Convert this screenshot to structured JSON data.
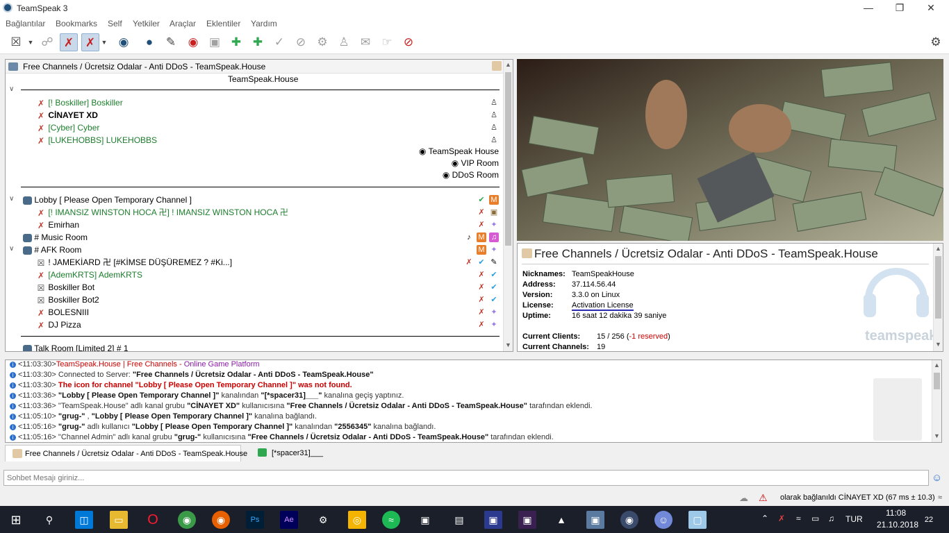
{
  "window": {
    "title": "TeamSpeak 3"
  },
  "menu": [
    "Bağlantılar",
    "Bookmarks",
    "Self",
    "Yetkiler",
    "Araçlar",
    "Eklentiler",
    "Yardım"
  ],
  "tree": {
    "server_name": "Free Channels / Ücretsiz Odalar - Anti DDoS - TeamSpeak.House",
    "spacer_title": "TeamSpeak.House",
    "clients_top": [
      {
        "name": "[!                    Boskiller] Boskiller",
        "green": true
      },
      {
        "name": "CİNAYET XD",
        "green": false
      },
      {
        "name": "[Cyber] Cyber",
        "green": true
      },
      {
        "name": "[LUKEHOBBS] LUKEHOBBS",
        "green": true
      }
    ],
    "right_channels": [
      "TeamSpeak House",
      "VIP Room",
      "DDoS Room"
    ],
    "lobby": "Lobby [ Please Open Temporary Channel ]",
    "lobby_clients": [
      {
        "name": "[!     IMANSIZ WINSTON HOCA 卍] !     IMANSIZ WINSTON HOCA 卍",
        "green": true
      },
      {
        "name": "Emirhan",
        "green": false
      }
    ],
    "music_room": "# Music Room",
    "afk_room": "# AFK Room",
    "afk_clients": [
      {
        "name": "!               JAMEKİARD 卍 [#KİMSE DÜŞÜREMEZ ? #Ki...]",
        "green": false
      },
      {
        "name": "[AdemKRTS] AdemKRTS",
        "green": true
      },
      {
        "name": "Boskiller Bot",
        "green": false
      },
      {
        "name": "Boskiller Bot2",
        "green": false
      },
      {
        "name": "BOLESNIII",
        "green": false
      },
      {
        "name": "DJ Pizza",
        "green": false
      }
    ],
    "talk_room": "Talk Room [Limited 2] # 1"
  },
  "info": {
    "title": "Free Channels / Ücretsiz Odalar - Anti DDoS - TeamSpeak.House",
    "nicknames_label": "Nicknames:",
    "nicknames": "TeamSpeakHouse",
    "address_label": "Address:",
    "address": "37.114.56.44",
    "version_label": "Version:",
    "version": "3.3.0 on Linux",
    "license_label": "License:",
    "license": "Activation License",
    "uptime_label": "Uptime:",
    "uptime": "16 saat 12 dakika 39 saniye",
    "clients_label": "Current Clients:",
    "clients": "15 / 256 (",
    "clients_reserved": "-1 reserved",
    "clients_close": ")",
    "channels_label": "Current Channels:",
    "channels": "19",
    "logo_text": "teamspeak"
  },
  "log": [
    {
      "time": "<11:03:30>",
      "parts": [
        {
          "t": "TeamSpeak.House | Free Channels",
          "c": "red"
        },
        {
          "t": " - ",
          "c": "red"
        },
        {
          "t": "Online Game Platform",
          "c": "purple"
        }
      ]
    },
    {
      "time": "<11:03:30>",
      "parts": [
        {
          "t": " Connected to Server: ",
          "c": ""
        },
        {
          "t": "\"Free Channels / Ücretsiz Odalar - Anti DDoS - TeamSpeak.House\"",
          "c": "b"
        }
      ]
    },
    {
      "time": "<11:03:30>",
      "parts": [
        {
          "t": " The icon for channel \"Lobby [ Please Open Temporary Channel ]\" was not found.",
          "c": "red b"
        }
      ]
    },
    {
      "time": "<11:03:36>",
      "parts": [
        {
          "t": " \"Lobby [ Please Open Temporary Channel ]\"",
          "c": "b"
        },
        {
          "t": " kanalından ",
          "c": ""
        },
        {
          "t": "\"[*spacer31]___\"",
          "c": "b"
        },
        {
          "t": " kanalına geçiş yaptınız.",
          "c": ""
        }
      ]
    },
    {
      "time": "<11:03:36>",
      "parts": [
        {
          "t": " \"TeamSpeak.House\" adlı kanal grubu ",
          "c": ""
        },
        {
          "t": "\"CİNAYET XD\"",
          "c": "b"
        },
        {
          "t": " kullanıcısına ",
          "c": ""
        },
        {
          "t": "\"Free Channels / Ücretsiz Odalar - Anti DDoS - TeamSpeak.House\"",
          "c": "b"
        },
        {
          "t": " tarafından eklendi.",
          "c": ""
        }
      ]
    },
    {
      "time": "<11:05:10>",
      "parts": [
        {
          "t": " \"grug-\"",
          "c": "b"
        },
        {
          "t": " , ",
          "c": ""
        },
        {
          "t": "\"Lobby [ Please Open Temporary Channel ]\"",
          "c": "b"
        },
        {
          "t": " kanalına bağlandı.",
          "c": ""
        }
      ]
    },
    {
      "time": "<11:05:16>",
      "parts": [
        {
          "t": " \"grug-\"",
          "c": "b"
        },
        {
          "t": " adlı kullanıcı ",
          "c": ""
        },
        {
          "t": "\"Lobby [ Please Open Temporary Channel ]\"",
          "c": "b"
        },
        {
          "t": " kanalından ",
          "c": ""
        },
        {
          "t": "\"2556345\"",
          "c": "b"
        },
        {
          "t": " kanalına bağlandı.",
          "c": ""
        }
      ]
    },
    {
      "time": "<11:05:16>",
      "parts": [
        {
          "t": " \"Channel Admin\" adlı kanal grubu ",
          "c": ""
        },
        {
          "t": "\"grug-\"",
          "c": "b"
        },
        {
          "t": " kullanıcısına ",
          "c": ""
        },
        {
          "t": "\"Free Channels / Ücretsiz Odalar - Anti DDoS - TeamSpeak.House\"",
          "c": "b"
        },
        {
          "t": " tarafından eklendi.",
          "c": ""
        }
      ]
    }
  ],
  "tabs": [
    {
      "label": "Free Channels / Ücretsiz Odalar - Anti DDoS - TeamSpeak.House"
    },
    {
      "label": "[*spacer31]___"
    }
  ],
  "chat": {
    "placeholder": "Sohbet Mesajı giriniz..."
  },
  "status": {
    "text": "olarak bağlanıldı CİNAYET XD (67 ms ± 10.3)"
  },
  "taskbar": {
    "lang": "TUR",
    "time": "11:08",
    "date": "21.10.2018",
    "notifications": "22"
  },
  "colors": {
    "accent": "#2a6fd0",
    "green_names": "#1c7d2c",
    "error": "#cc0000"
  }
}
